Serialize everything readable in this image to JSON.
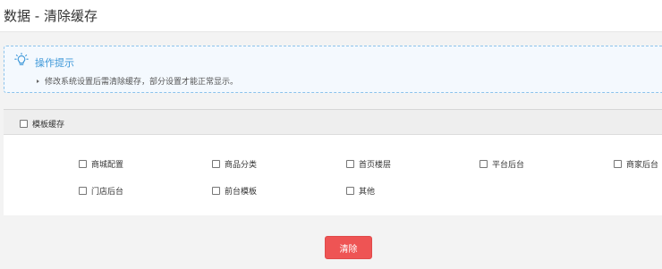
{
  "header": {
    "title": "数据 - 清除缓存"
  },
  "tips": {
    "icon": "lightbulb-icon",
    "title": "操作提示",
    "items": [
      "修改系统设置后需清除缓存，部分设置才能正常显示。"
    ]
  },
  "panel": {
    "master_checkbox": {
      "label": "模板缓存",
      "checked": false
    },
    "options": [
      {
        "label": "商城配置",
        "checked": false
      },
      {
        "label": "商品分类",
        "checked": false
      },
      {
        "label": "首页楼层",
        "checked": false
      },
      {
        "label": "平台后台",
        "checked": false
      },
      {
        "label": "商家后台",
        "checked": false
      },
      {
        "label": "门店后台",
        "checked": false
      },
      {
        "label": "前台模板",
        "checked": false
      },
      {
        "label": "其他",
        "checked": false
      }
    ]
  },
  "actions": {
    "clear_label": "清除",
    "clear_color": "#ee5454"
  },
  "colors": {
    "accent": "#3c97d8",
    "danger": "#ee5454"
  }
}
